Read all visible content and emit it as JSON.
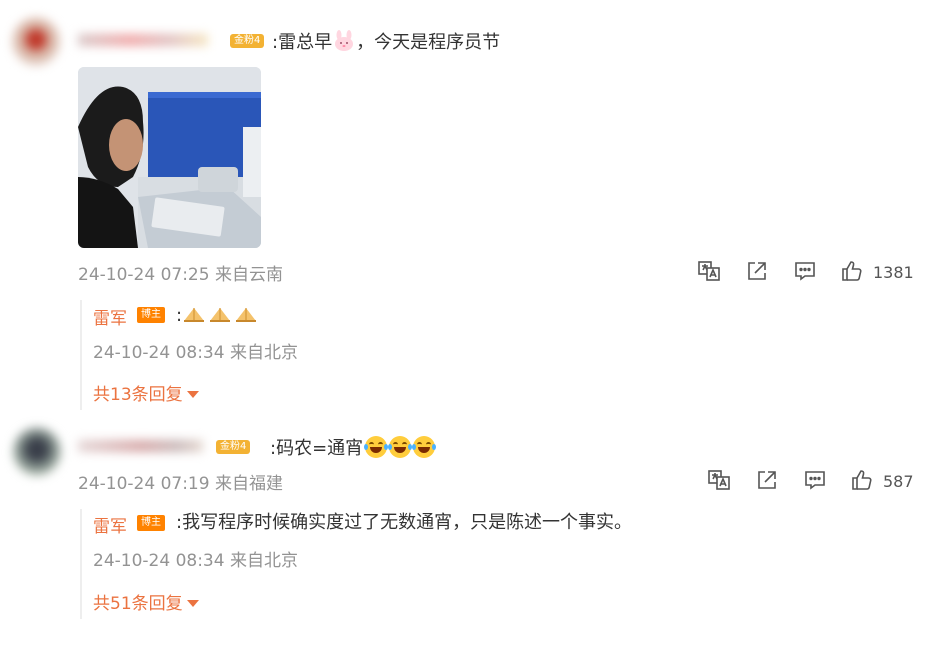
{
  "comments": [
    {
      "fan_badge": "金粉4",
      "text_prefix": ":雷总早",
      "emoji": "bunny-emoji",
      "text_suffix": "，今天是程序员节",
      "meta": "24-10-24 07:25 来自云南",
      "likes": "1381",
      "reply": {
        "author": "雷军",
        "badge": "博主",
        "text": ":",
        "emoji_count": 3,
        "meta": "24-10-24 08:34 来自北京"
      },
      "more_replies": "共13条回复"
    },
    {
      "fan_badge": "金粉4",
      "text": ":码农=通宵",
      "emoji_count": 3,
      "meta": "24-10-24 07:19 来自福建",
      "likes": "587",
      "reply": {
        "author": "雷军",
        "badge": "博主",
        "text": ":我写程序时候确实度过了无数通宵，只是陈述一个事实。",
        "meta": "24-10-24 08:34 来自北京"
      },
      "more_replies": "共51条回复"
    }
  ],
  "icons": {
    "translate": "translate-icon",
    "share": "share-icon",
    "comment": "comment-icon",
    "like": "thumbs-up-icon",
    "expand": "caret-down-icon"
  },
  "colors": {
    "accent": "#eb7340",
    "meta": "#939393",
    "blogger_badge": "#ff8200",
    "fan_badge": "#f3b233"
  }
}
